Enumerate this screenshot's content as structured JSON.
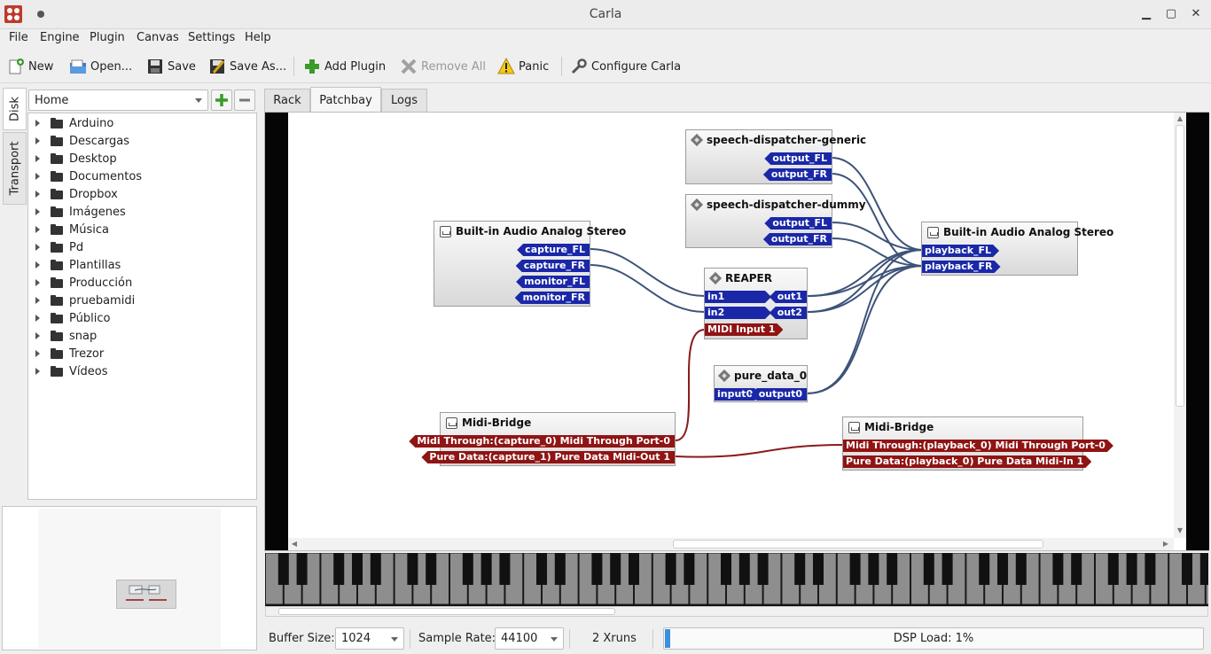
{
  "window": {
    "title": "Carla"
  },
  "menu": [
    "File",
    "Engine",
    "Plugin",
    "Canvas",
    "Settings",
    "Help"
  ],
  "toolbar": {
    "new": "New",
    "open": "Open...",
    "save": "Save",
    "save_as": "Save As...",
    "add_plugin": "Add Plugin",
    "remove_all": "Remove All",
    "panic": "Panic",
    "configure": "Configure Carla"
  },
  "side_tabs": {
    "disk": "Disk",
    "transport": "Transport"
  },
  "location": {
    "value": "Home"
  },
  "folders": [
    {
      "name": "Arduino",
      "icon": "folder-icon"
    },
    {
      "name": "Descargas",
      "icon": "download-icon"
    },
    {
      "name": "Desktop",
      "icon": "desktop-icon"
    },
    {
      "name": "Documentos",
      "icon": "document-icon"
    },
    {
      "name": "Dropbox",
      "icon": "folder-icon"
    },
    {
      "name": "Imágenes",
      "icon": "image-icon"
    },
    {
      "name": "Música",
      "icon": "music-icon"
    },
    {
      "name": "Pd",
      "icon": "document-icon"
    },
    {
      "name": "Plantillas",
      "icon": "template-icon"
    },
    {
      "name": "Producción",
      "icon": "folder-icon"
    },
    {
      "name": "pruebamidi",
      "icon": "folder-icon"
    },
    {
      "name": "Público",
      "icon": "user-icon"
    },
    {
      "name": "snap",
      "icon": "folder-icon"
    },
    {
      "name": "Trezor",
      "icon": "folder-icon"
    },
    {
      "name": "Vídeos",
      "icon": "video-icon"
    }
  ],
  "tabs": {
    "rack": "Rack",
    "patchbay": "Patchbay",
    "logs": "Logs",
    "active": "Patchbay"
  },
  "patchbay": {
    "sd_generic": {
      "title": "speech-dispatcher-generic",
      "out1": "output_FL",
      "out2": "output_FR"
    },
    "sd_dummy": {
      "title": "speech-dispatcher-dummy",
      "out1": "output_FL",
      "out2": "output_FR"
    },
    "capture": {
      "title": "Built-in Audio Analog Stereo",
      "p1": "capture_FL",
      "p2": "capture_FR",
      "p3": "monitor_FL",
      "p4": "monitor_FR"
    },
    "playback": {
      "title": "Built-in Audio Analog Stereo",
      "p1": "playback_FL",
      "p2": "playback_FR"
    },
    "reaper": {
      "title": "REAPER",
      "in1": "in1",
      "in2": "in2",
      "out1": "out1",
      "out2": "out2",
      "midi": "MIDI Input 1"
    },
    "pure_data": {
      "title": "pure_data_0",
      "in": "input0",
      "out": "output0"
    },
    "midi_bridge_out": {
      "title": "Midi-Bridge",
      "p1": "Midi Through:(capture_0) Midi Through Port-0",
      "p2": "Pure Data:(capture_1) Pure Data Midi-Out 1"
    },
    "midi_bridge_in": {
      "title": "Midi-Bridge",
      "p1": "Midi Through:(playback_0) Midi Through Port-0",
      "p2": "Pure Data:(playback_0) Pure Data Midi-In 1"
    },
    "colors": {
      "audio": "#1a28a8",
      "midi": "#8f1414",
      "audio_wire": "#3d5378",
      "midi_wire": "#8a1a1a"
    }
  },
  "status": {
    "buffer_label": "Buffer Size:",
    "buffer_value": "1024",
    "rate_label": "Sample Rate:",
    "rate_value": "44100",
    "xruns": "2 Xruns",
    "dsp_label": "DSP Load: 1%",
    "dsp_fraction": 0.01
  }
}
